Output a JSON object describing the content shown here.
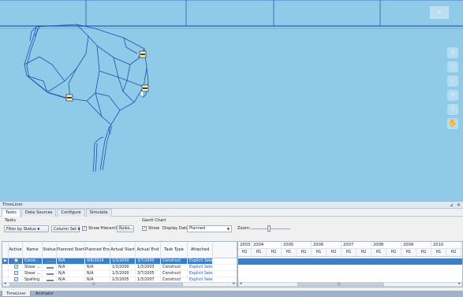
{
  "viewport": {
    "tool_icons": [
      "zoom-window-icon",
      "look-around-icon",
      "zoom-icon",
      "orbit-icon",
      "walk-icon",
      "pan-icon"
    ],
    "colors": {
      "sky": "#8fcbe8",
      "model_lines": "#1f4fb0",
      "grid_line": "#2d5fb0"
    }
  },
  "panel": {
    "title": "TimeLiner",
    "pin_glyph": "⊿",
    "close_glyph": "✕",
    "tabs": [
      "Tasks",
      "Data Sources",
      "Configure",
      "Simulate"
    ],
    "active_tab": "Tasks"
  },
  "toolbar": {
    "tasks_group_label": "Tasks",
    "filter_button": "Filter by Status",
    "column_set_button": "Column Set",
    "show_hierarchy_label": "Show Hierarchy",
    "show_hierarchy_checked": true,
    "rules_button": "Rules...",
    "gantt_group_label": "Gantt Chart",
    "show_label": "Show",
    "show_checked": true,
    "display_dates_label": "Display Dates:",
    "display_dates_value": "Planned",
    "zoom_label": "Zoom:",
    "dropdown_glyph": "▼"
  },
  "grid": {
    "columns": [
      "",
      "Active",
      "Name",
      "Status",
      "Planned Start",
      "Planned End",
      "Actual Start",
      "Actual End",
      "Task Type",
      "Attached"
    ],
    "rows": [
      {
        "indicator": "▶",
        "active": true,
        "name": "Const...",
        "planned_start": "N/A",
        "planned_end": "4/6/2014",
        "actual_start": "1/3/2000",
        "actual_end": "3/7/2000",
        "task_type": "Construct",
        "attached": "Explicit Selectio",
        "selected": true
      },
      {
        "indicator": "",
        "active": true,
        "name": "Shear ...",
        "planned_start": "N/A",
        "planned_end": "N/A",
        "actual_start": "1/3/2000",
        "actual_end": "1/3/2003",
        "task_type": "Construct",
        "attached": "Explicit Selectio",
        "selected": false
      },
      {
        "indicator": "",
        "active": true,
        "name": "Shear ...",
        "planned_start": "N/A",
        "planned_end": "N/A",
        "actual_start": "1/3/2000",
        "actual_end": "3/7/2005",
        "task_type": "Construct",
        "attached": "Explicit Selectio",
        "selected": false
      },
      {
        "indicator": "",
        "active": true,
        "name": "Spalling",
        "planned_start": "N/A",
        "planned_end": "N/A",
        "actual_start": "1/3/2005",
        "actual_end": "1/3/2007",
        "task_type": "Construct",
        "attached": "Explicit Selectio",
        "selected": false
      }
    ]
  },
  "gantt": {
    "years": [
      "2003",
      "2004",
      "2005",
      "2006",
      "2007",
      "2008",
      "2009",
      "2010"
    ],
    "halves": [
      "H2",
      "H1",
      "H2",
      "H1",
      "H2",
      "H1",
      "H2",
      "H1",
      "H2",
      "H1",
      "H2",
      "H1",
      "H2",
      "H1",
      "H2",
      "H1"
    ],
    "colors": {
      "selected_row": "#3b80c6"
    }
  },
  "scrollbars": {
    "left_label": "III",
    "right_label": "III",
    "left_arrow": "◂",
    "right_arrow": "▸"
  },
  "bottom_tabs": [
    "TimeLiner",
    "Animator"
  ],
  "check_glyph": "✓"
}
